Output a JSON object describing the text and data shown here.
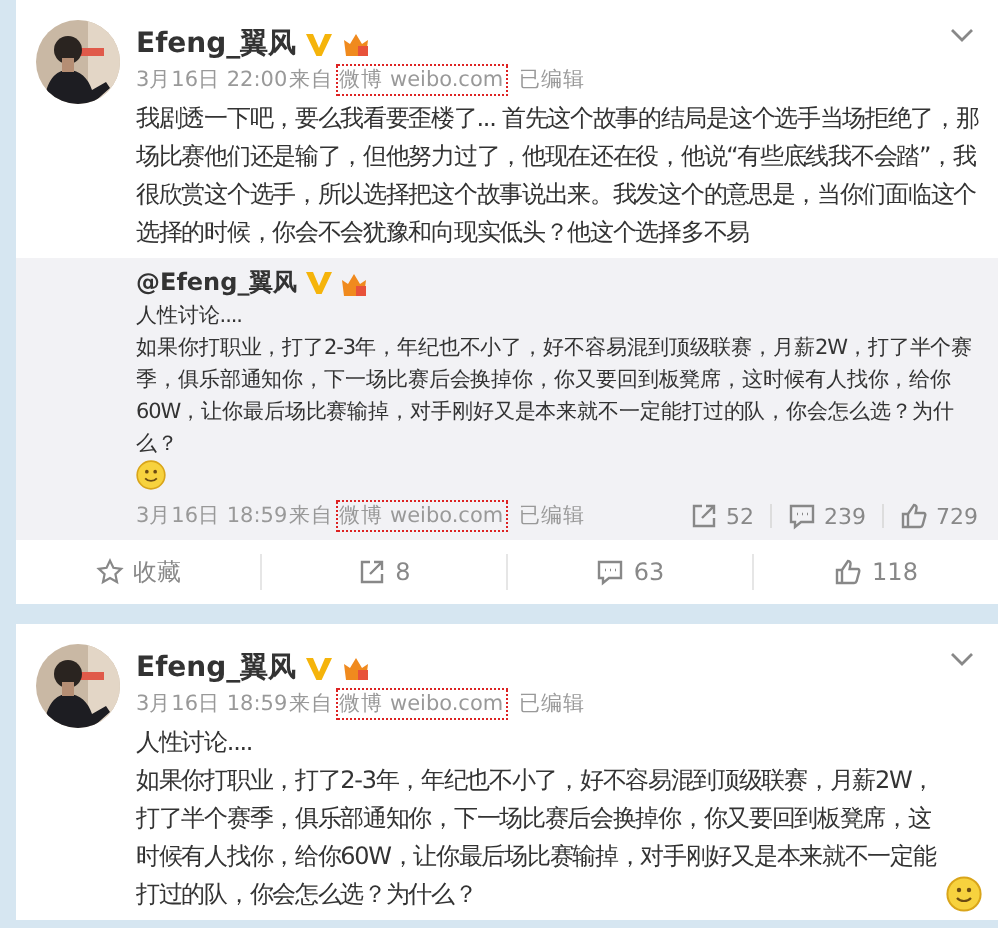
{
  "posts": [
    {
      "author": "Efeng_翼风",
      "verified": true,
      "time": "3月16日 22:00",
      "via": "来自",
      "source": "微博 weibo.com",
      "edited": "已编辑",
      "paragraphs": [
        "我剧透一下吧，要么我看要歪楼了... 首先这个故事的结局是这个选手当场拒绝了，那场比赛他们还是输了，但他努力过了，他现在还在役，他说“有些底线我不会踏”，我很欣赏这个选手，所以选择把这个故事说出来。我发这个的意思是，当你们面临这个选择的时候，你会不会犹豫和向现实低头？他这个选择多不易"
      ],
      "repost": {
        "author": "@Efeng_翼风",
        "verified": true,
        "emoji": true,
        "paragraphs": [
          "人性讨论....",
          "如果你打职业，打了2-3年，年纪也不小了，好不容易混到顶级联赛，月薪2W，打了半个赛季，俱乐部通知你，下一场比赛后会换掉你，你又要回到板凳席，这时候有人找你，给你60W，让你最后场比赛输掉，对手刚好又是本来就不一定能打过的队，你会怎么选？为什么？"
        ],
        "time": "3月16日 18:59",
        "via": "来自",
        "source": "微博 weibo.com",
        "edited": "已编辑",
        "stats": [
          {
            "kind": "repost",
            "label": "52"
          },
          {
            "kind": "comment",
            "label": "239"
          },
          {
            "kind": "like",
            "label": "729"
          }
        ]
      },
      "actions": [
        {
          "kind": "favorite",
          "label": "收藏"
        },
        {
          "kind": "repost",
          "label": "8"
        },
        {
          "kind": "comment",
          "label": "63"
        },
        {
          "kind": "like",
          "label": "118"
        }
      ]
    },
    {
      "author": "Efeng_翼风",
      "verified": true,
      "emoji": true,
      "time": "3月16日 18:59",
      "via": "来自",
      "source": "微博 weibo.com",
      "edited": "已编辑",
      "paragraphs": [
        "人性讨论....",
        "如果你打职业，打了2-3年，年纪也不小了，好不容易混到顶级联赛，月薪2W，打了半个赛季，俱乐部通知你，下一场比赛后会换掉你，你又要回到板凳席，这时候有人找你，给你60W，让你最后场比赛输掉，对手刚好又是本来就不一定能打过的队，你会怎么选？为什么？"
      ]
    }
  ]
}
